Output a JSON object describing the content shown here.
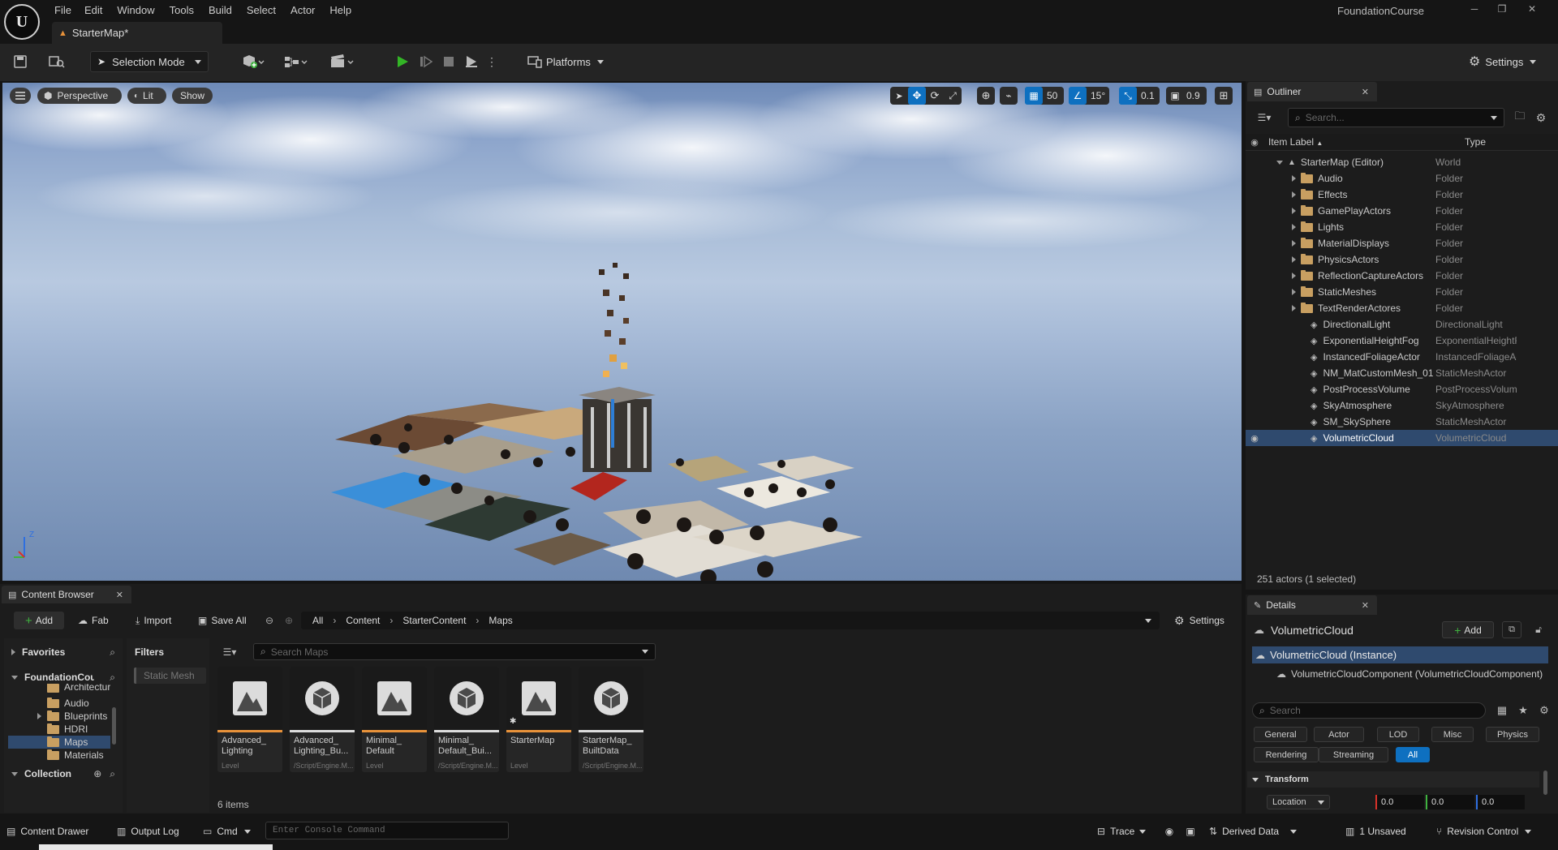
{
  "app": {
    "project_name": "FoundationCourse"
  },
  "menu": [
    "File",
    "Edit",
    "Window",
    "Tools",
    "Build",
    "Select",
    "Actor",
    "Help"
  ],
  "tab": {
    "label": "StarterMap*"
  },
  "toolbar": {
    "selection_mode": "Selection Mode",
    "platforms": "Platforms",
    "settings": "Settings"
  },
  "viewport": {
    "perspective": "Perspective",
    "lit": "Lit",
    "show": "Show",
    "grid_size": "50",
    "rotation_snap": "15°",
    "scale_snap": "0.1",
    "camera_speed": "0.9",
    "axis_z": "Z"
  },
  "outliner": {
    "title": "Outliner",
    "search_placeholder": "Search...",
    "col_label": "Item Label",
    "col_type": "Type",
    "items": [
      {
        "label": "StarterMap (Editor)",
        "type": "World",
        "kind": "world"
      },
      {
        "label": "Audio",
        "type": "Folder",
        "kind": "folder"
      },
      {
        "label": "Effects",
        "type": "Folder",
        "kind": "folder"
      },
      {
        "label": "GamePlayActors",
        "type": "Folder",
        "kind": "folder"
      },
      {
        "label": "Lights",
        "type": "Folder",
        "kind": "folder"
      },
      {
        "label": "MaterialDisplays",
        "type": "Folder",
        "kind": "folder"
      },
      {
        "label": "PhysicsActors",
        "type": "Folder",
        "kind": "folder"
      },
      {
        "label": "ReflectionCaptureActors",
        "type": "Folder",
        "kind": "folder"
      },
      {
        "label": "StaticMeshes",
        "type": "Folder",
        "kind": "folder"
      },
      {
        "label": "TextRenderActores",
        "type": "Folder",
        "kind": "folder"
      },
      {
        "label": "DirectionalLight",
        "type": "DirectionalLight",
        "kind": "actor"
      },
      {
        "label": "ExponentialHeightFog",
        "type": "ExponentialHeightFog",
        "kind": "actor"
      },
      {
        "label": "InstancedFoliageActor",
        "type": "InstancedFoliageActor",
        "kind": "actor"
      },
      {
        "label": "NM_MatCustomMesh_01",
        "type": "StaticMeshActor",
        "kind": "actor"
      },
      {
        "label": "PostProcessVolume",
        "type": "PostProcessVolume",
        "kind": "actor"
      },
      {
        "label": "SkyAtmosphere",
        "type": "SkyAtmosphere",
        "kind": "actor"
      },
      {
        "label": "SM_SkySphere",
        "type": "StaticMeshActor",
        "kind": "actor"
      },
      {
        "label": "VolumetricCloud",
        "type": "VolumetricCloud",
        "kind": "actor"
      }
    ],
    "status": "251 actors (1 selected)"
  },
  "details": {
    "title": "Details",
    "actor_name": "VolumetricCloud",
    "add_label": "Add",
    "instance_label": "VolumetricCloud (Instance)",
    "component_label": "VolumetricCloudComponent (VolumetricCloudComponent)",
    "search_placeholder": "Search",
    "categories_row1": [
      "General",
      "Actor",
      "LOD",
      "Misc",
      "Physics"
    ],
    "categories_row2": [
      "Rendering",
      "Streaming",
      "All"
    ],
    "section_transform": "Transform",
    "location_label": "Location",
    "location": [
      "0.0",
      "0.0",
      "0.0"
    ]
  },
  "content_browser": {
    "title": "Content Browser",
    "add": "Add",
    "fab": "Fab",
    "import": "Import",
    "save_all": "Save All",
    "breadcrumb": [
      "All",
      "Content",
      "StarterContent",
      "Maps"
    ],
    "settings": "Settings",
    "favorites": "Favorites",
    "root": "FoundationCourse",
    "tree": [
      "Architecture",
      "Audio",
      "Blueprints",
      "HDRI",
      "Maps",
      "Materials"
    ],
    "collection": "Collection",
    "filters": "Filters",
    "filter_chip": "Static Mesh",
    "search_placeholder": "Search Maps",
    "assets": [
      {
        "name": "Advanced_\nLighting",
        "type": "Level",
        "icon": "level",
        "bar": "#e8923a"
      },
      {
        "name": "Advanced_\nLighting_Bu...",
        "type": "/Script/Engine.M...",
        "icon": "data",
        "bar": "#dddddd"
      },
      {
        "name": "Minimal_\nDefault",
        "type": "Level",
        "icon": "level",
        "bar": "#e8923a"
      },
      {
        "name": "Minimal_\nDefault_Bui...",
        "type": "/Script/Engine.M...",
        "icon": "data",
        "bar": "#dddddd"
      },
      {
        "name": "StarterMap",
        "type": "Level",
        "icon": "level",
        "bar": "#e8923a"
      },
      {
        "name": "StarterMap_\nBuiltData",
        "type": "/Script/Engine.M...",
        "icon": "data",
        "bar": "#dddddd"
      }
    ],
    "item_count": "6 items"
  },
  "statusbar": {
    "content_drawer": "Content Drawer",
    "output_log": "Output Log",
    "cmd": "Cmd",
    "console_placeholder": "Enter Console Command",
    "trace": "Trace",
    "derived_data": "Derived Data",
    "unsaved": "1 Unsaved",
    "revision_control": "Revision Control"
  },
  "colors": {
    "accent": "#0e70c0",
    "play": "#33b526",
    "selected_row": "#2f4a6e"
  }
}
